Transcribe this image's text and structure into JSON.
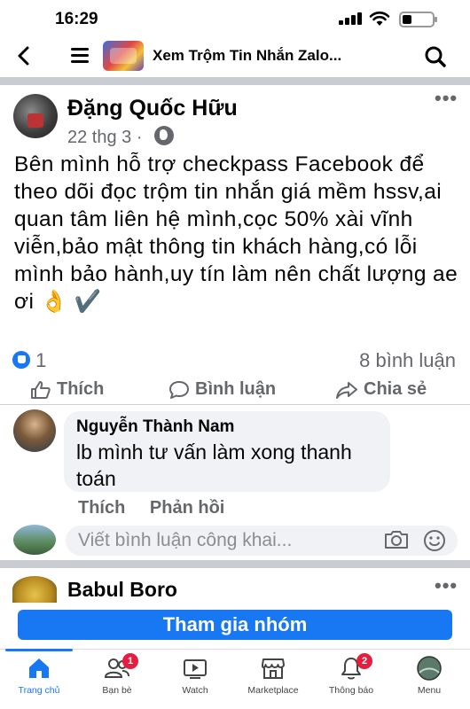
{
  "status_bar": {
    "time": "16:29"
  },
  "top_bar": {
    "group_title": "Xem Trộm Tin Nhắn Zalo..."
  },
  "post": {
    "author": "Đặng Quốc Hữu",
    "date": "22 thg 3",
    "date_separator": "·",
    "privacy_icon": "globe-icon",
    "body": "Bên mình hỗ trợ checkpass Facebook để theo dõi đọc trộm tin nhắn giá mềm hssv,ai quan tâm liên hệ mình,cọc 50% xài vĩnh viễn,bảo mật thông tin khách hàng,có lỗi mình bảo hành,uy tín làm nên chất lượng ae ơi 👌 ✔️",
    "reaction_count": "1",
    "comment_count": "8 bình luận",
    "actions": {
      "like": "Thích",
      "comment": "Bình luận",
      "share": "Chia sẻ"
    }
  },
  "comment": {
    "author": "Nguyễn Thành Nam",
    "text": "lb mình tư vấn làm xong thanh toán",
    "like_label": "Thích",
    "reply_label": "Phản hồi"
  },
  "comment_input": {
    "placeholder": "Viết bình luận công khai..."
  },
  "post2": {
    "author": "Babul Boro"
  },
  "join_button": {
    "label": "Tham gia nhóm"
  },
  "tab_bar": {
    "tabs": [
      {
        "label": "Trang chủ",
        "icon": "home-icon",
        "active": true
      },
      {
        "label": "Bạn bè",
        "icon": "friends-icon",
        "badge": "1"
      },
      {
        "label": "Watch",
        "icon": "watch-icon"
      },
      {
        "label": "Marketplace",
        "icon": "marketplace-icon"
      },
      {
        "label": "Thông báo",
        "icon": "bell-icon",
        "badge": "2"
      },
      {
        "label": "Menu",
        "icon": "menu-avatar-icon"
      }
    ]
  },
  "colors": {
    "accent": "#1877f2",
    "badge": "#e41e3f",
    "secondary_text": "#65676b"
  }
}
